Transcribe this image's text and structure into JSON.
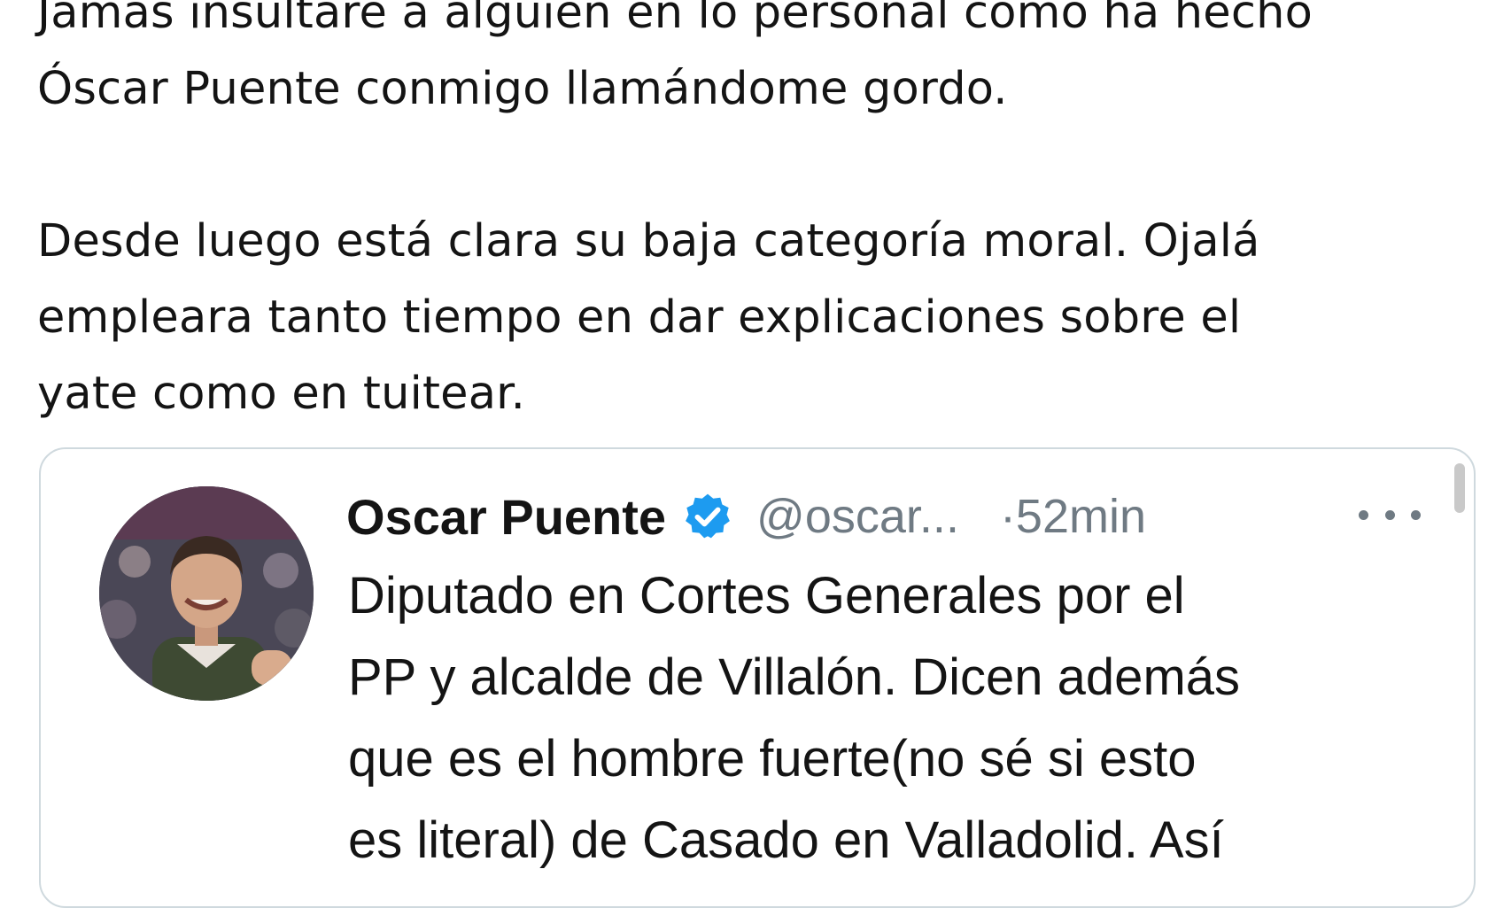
{
  "tweet": {
    "paragraph_1": "Jamás insultaré a alguien en lo personal como ha hecho\nÓscar Puente conmigo llamándome gordo.",
    "paragraph_2": "Desde luego está clara su baja categoría moral. Ojalá\nempleara tanto tiempo en dar explicaciones sobre el\nyate como en tuitear."
  },
  "quoted_tweet": {
    "author_name": "Oscar Puente",
    "handle": "@oscar...",
    "time": "·52min",
    "body": "Diputado en Cortes Generales por el\nPP y alcalde de Villalón. Dicen además\nque es el hombre fuerte(no sé si esto\nes literal) de Casado en Valladolid. Así"
  },
  "icons": {
    "verified": "verified-badge-icon",
    "more": "more-options-icon"
  },
  "colors": {
    "verified_blue": "#1d9bf0",
    "secondary_text": "#6f7a83",
    "card_border": "#cfd9de"
  }
}
